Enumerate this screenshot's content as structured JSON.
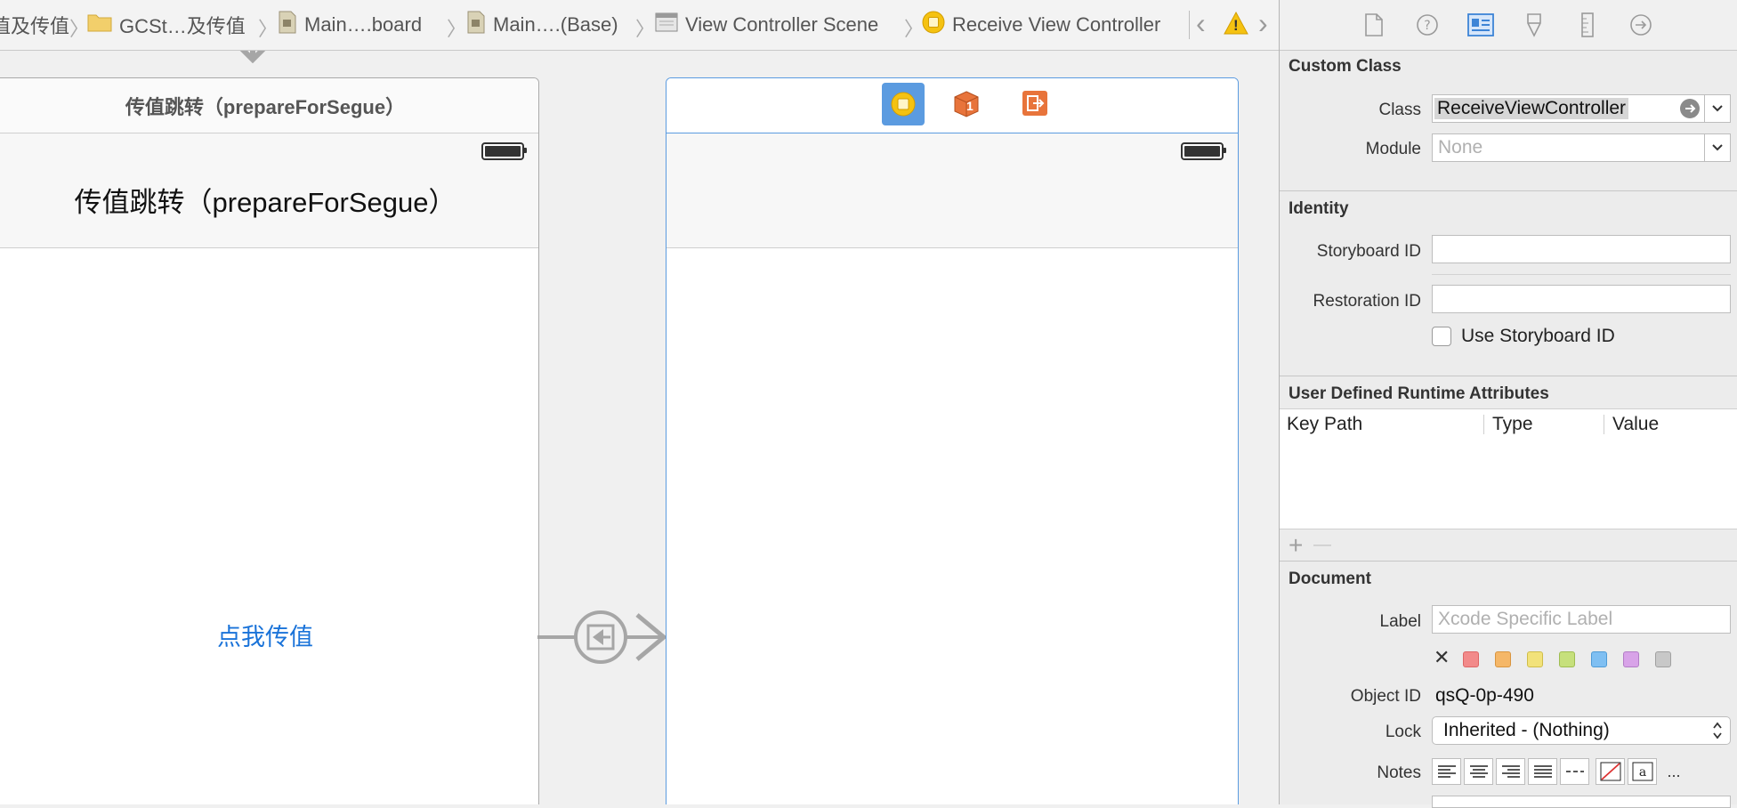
{
  "breadcrumb": {
    "items": [
      {
        "label": "值及传值",
        "icon": "folder-icon"
      },
      {
        "label": "GCSt…及传值",
        "icon": "folder-icon"
      },
      {
        "label": "Main….board",
        "icon": "storyboard-file-icon"
      },
      {
        "label": "Main….(Base)",
        "icon": "storyboard-file-icon"
      },
      {
        "label": "View Controller Scene",
        "icon": "scene-icon"
      },
      {
        "label": "Receive View Controller",
        "icon": "view-controller-icon"
      }
    ],
    "back_glyph": "‹",
    "forward_glyph": "›",
    "warning_glyph": "!"
  },
  "canvas": {
    "left_scene": {
      "title": "传值跳转（prepareForSegue）",
      "nav_title": "传值跳转（prepareForSegue）",
      "button_label": "点我传值"
    },
    "right_scene": {
      "dock_icons": [
        "view-controller-icon",
        "first-responder-icon",
        "exit-icon"
      ],
      "dock_badge": "1"
    }
  },
  "inspector": {
    "tabs": [
      "file-inspector-icon",
      "quick-help-icon",
      "identity-inspector-icon",
      "attributes-inspector-icon",
      "size-inspector-icon",
      "connections-inspector-icon"
    ],
    "custom_class": {
      "title": "Custom Class",
      "class_label": "Class",
      "class_value": "ReceiveViewController",
      "module_label": "Module",
      "module_placeholder": "None"
    },
    "identity": {
      "title": "Identity",
      "storyboard_id_label": "Storyboard ID",
      "storyboard_id_value": "",
      "restoration_id_label": "Restoration ID",
      "restoration_id_value": "",
      "use_storyboard_id_label": "Use Storyboard ID"
    },
    "runtime_attributes": {
      "title": "User Defined Runtime Attributes",
      "columns": [
        "Key Path",
        "Type",
        "Value"
      ],
      "add_glyph": "+",
      "remove_glyph": "—"
    },
    "document": {
      "title": "Document",
      "label_label": "Label",
      "label_placeholder": "Xcode Specific Label",
      "clear_glyph": "✕",
      "swatch_colors": [
        "#f28a8a",
        "#f5b768",
        "#f2e27a",
        "#c6e07c",
        "#7fbff2",
        "#d8a3e8",
        "#c8c8c8"
      ],
      "object_id_label": "Object ID",
      "object_id_value": "qsQ-0p-490",
      "lock_label": "Lock",
      "lock_value": "Inherited - (Nothing)",
      "notes_label": "Notes",
      "notes_more": "..."
    }
  },
  "colors": {
    "accent_blue": "#1a73d9",
    "selection_blue": "#5b9be0",
    "warning_yellow": "#f5c211",
    "storyboard_orange": "#e8743b"
  }
}
